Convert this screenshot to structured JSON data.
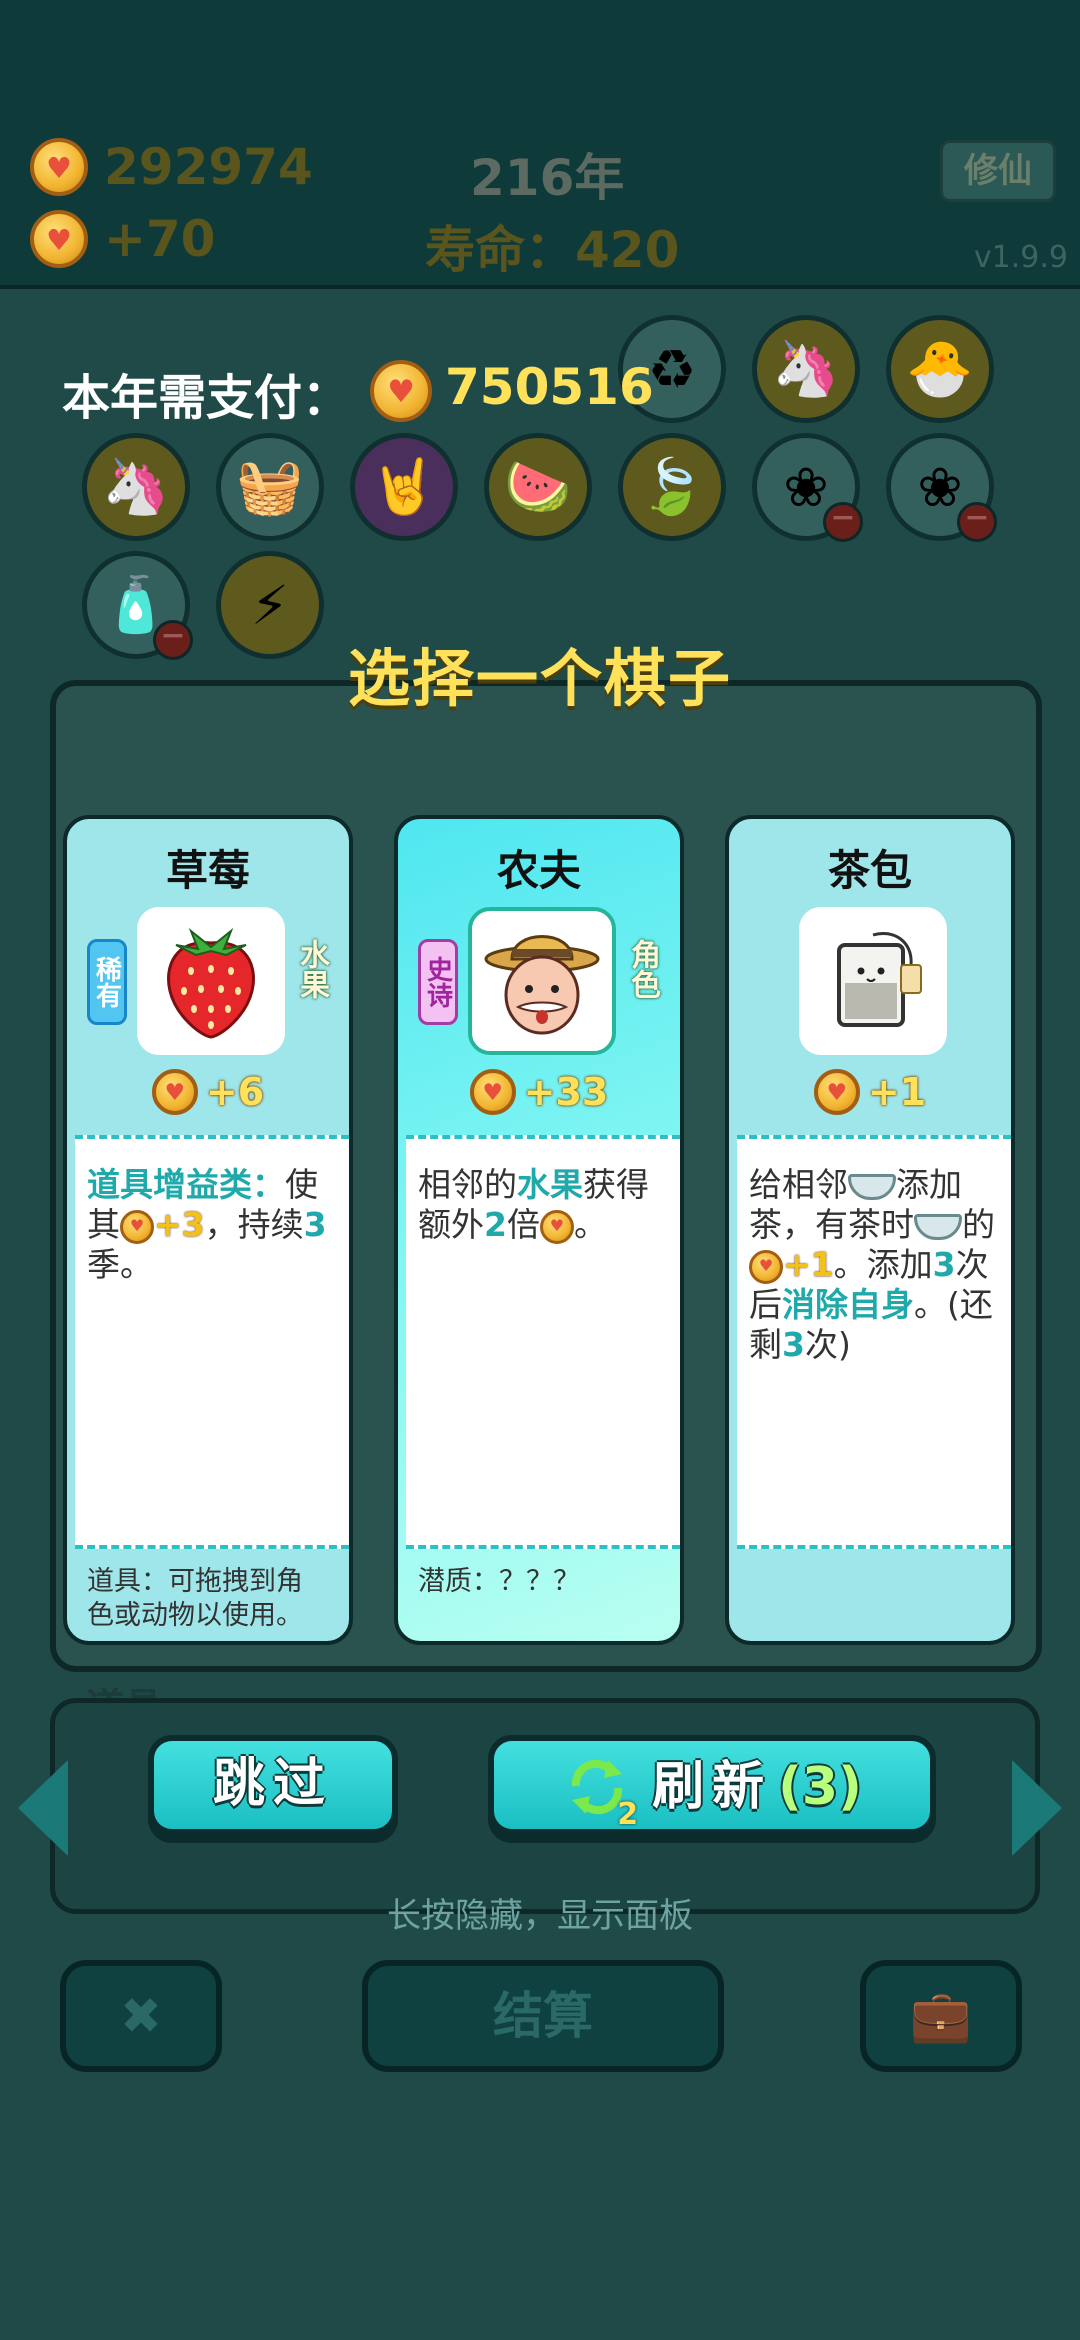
{
  "background": {
    "coins_total": "292974",
    "coins_delta": "+70",
    "year": "216年",
    "lifespan": "寿命：420",
    "xiuxian_button": "修仙",
    "version": "v1.9.9",
    "items_label": "道具",
    "settle_button": "结算"
  },
  "overlay": {
    "pay_label": "本年需支付：",
    "pay_value": "750516",
    "choose_title": "选择一个棋子",
    "hint": "长按隐藏，显示面板"
  },
  "cards": [
    {
      "name": "草莓",
      "rarity": "稀有",
      "rarity_color": "#52c6f1",
      "type": "水果",
      "value": "+6",
      "icon": "strawberry-icon",
      "desc_parts": [
        "道具增益类：",
        "使其",
        "+3",
        "，持续",
        "3",
        "季。"
      ],
      "footer": "道具：可拖拽到角色或动物以使用。"
    },
    {
      "name": "农夫",
      "rarity": "史诗",
      "rarity_color": "#f4c1f3",
      "type": "角色",
      "value": "+33",
      "icon": "farmer-icon",
      "desc_parts": [
        "相邻的",
        "水果",
        "获得额外",
        "2",
        "倍",
        "。"
      ],
      "footer": "潜质：？？？"
    },
    {
      "name": "茶包",
      "rarity": "",
      "type": "",
      "value": "+1",
      "icon": "teabag-icon",
      "desc_parts": [
        "给相邻",
        "添加茶，有茶时",
        "的",
        "+1",
        "。添加",
        "3",
        "次后",
        "消除自身",
        "。(还剩",
        "3",
        "次)"
      ],
      "footer": ""
    }
  ],
  "buttons": {
    "skip": "跳过",
    "refresh": "刷新",
    "refresh_count": "(3)",
    "refresh_badge": "2"
  },
  "colors": {
    "accent": "#1bbfc2",
    "gold_text": "#ffe259",
    "highlight": "#20a9ab"
  }
}
